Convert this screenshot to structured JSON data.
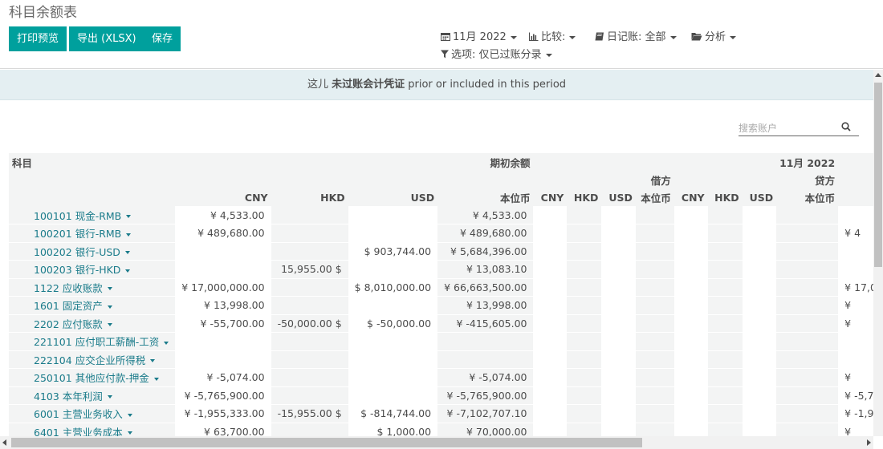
{
  "page_title": "科目余额表",
  "buttons": {
    "print_preview": "打印预览",
    "export_xlsx": "导出 (XLSX)",
    "save": "保存"
  },
  "filters": {
    "date": "11月 2022",
    "compare": "比较:",
    "journals": "日记账: 全部",
    "analysis": "分析",
    "options": "选项: 仅已过账分录"
  },
  "notice": {
    "prefix": "这儿",
    "bold": "未过账会计凭证",
    "suffix": "prior or included in this period"
  },
  "search": {
    "placeholder": "搜索账户"
  },
  "table": {
    "header_account": "科目",
    "header_opening": "期初余额",
    "header_period": "11月 2022",
    "header_debit": "借方",
    "header_credit": "贷方",
    "col_cny": "CNY",
    "col_hkd": "HKD",
    "col_usd": "USD",
    "col_base": "本位币",
    "rows": [
      {
        "account": "100101 现金-RMB",
        "cny": "¥ 4,533.00",
        "hkd": "",
        "usd": "",
        "base": "¥ 4,533.00",
        "edge": ""
      },
      {
        "account": "100201 银行-RMB",
        "cny": "¥ 489,680.00",
        "hkd": "",
        "usd": "",
        "base": "¥ 489,680.00",
        "edge": "¥ 4"
      },
      {
        "account": "100202 银行-USD",
        "cny": "",
        "hkd": "",
        "usd": "$ 903,744.00",
        "base": "¥ 5,684,396.00",
        "edge": ""
      },
      {
        "account": "100203 银行-HKD",
        "cny": "",
        "hkd": "15,955.00 $",
        "usd": "",
        "base": "¥ 13,083.10",
        "edge": ""
      },
      {
        "account": "1122 应收账款",
        "cny": "¥ 17,000,000.00",
        "hkd": "",
        "usd": "$ 8,010,000.00",
        "base": "¥ 66,663,500.00",
        "edge": "¥ 17,0"
      },
      {
        "account": "1601 固定资产",
        "cny": "¥ 13,998.00",
        "hkd": "",
        "usd": "",
        "base": "¥ 13,998.00",
        "edge": "¥"
      },
      {
        "account": "2202 应付账款",
        "cny": "¥ -55,700.00",
        "hkd": "-50,000.00 $",
        "usd": "$ -50,000.00",
        "base": "¥ -415,605.00",
        "edge": "¥"
      },
      {
        "account": "221101 应付职工薪酬-工资",
        "cny": "",
        "hkd": "",
        "usd": "",
        "base": "",
        "edge": ""
      },
      {
        "account": "222104 应交企业所得税",
        "cny": "",
        "hkd": "",
        "usd": "",
        "base": "",
        "edge": ""
      },
      {
        "account": "250101 其他应付款-押金",
        "cny": "¥ -5,074.00",
        "hkd": "",
        "usd": "",
        "base": "¥ -5,074.00",
        "edge": "¥"
      },
      {
        "account": "4103 本年利润",
        "cny": "¥ -5,765,900.00",
        "hkd": "",
        "usd": "",
        "base": "¥ -5,765,900.00",
        "edge": "¥ -5,7"
      },
      {
        "account": "6001 主营业务收入",
        "cny": "¥ -1,955,333.00",
        "hkd": "-15,955.00 $",
        "usd": "$ -814,744.00",
        "base": "¥ -7,102,707.10",
        "edge": "¥ -1,9"
      },
      {
        "account": "6401 主营业务成本",
        "cny": "¥ 63,700.00",
        "hkd": "",
        "usd": "$ 1,000.00",
        "base": "¥ 70,000.00",
        "edge": "¥"
      }
    ]
  },
  "colors": {
    "primary": "#00a09d",
    "link": "#1a7b8a",
    "notice_bg": "#e4eff2"
  },
  "icons": [
    "calendar-icon",
    "bar-chart-icon",
    "book-icon",
    "folder-icon",
    "filter-icon",
    "search-icon"
  ]
}
